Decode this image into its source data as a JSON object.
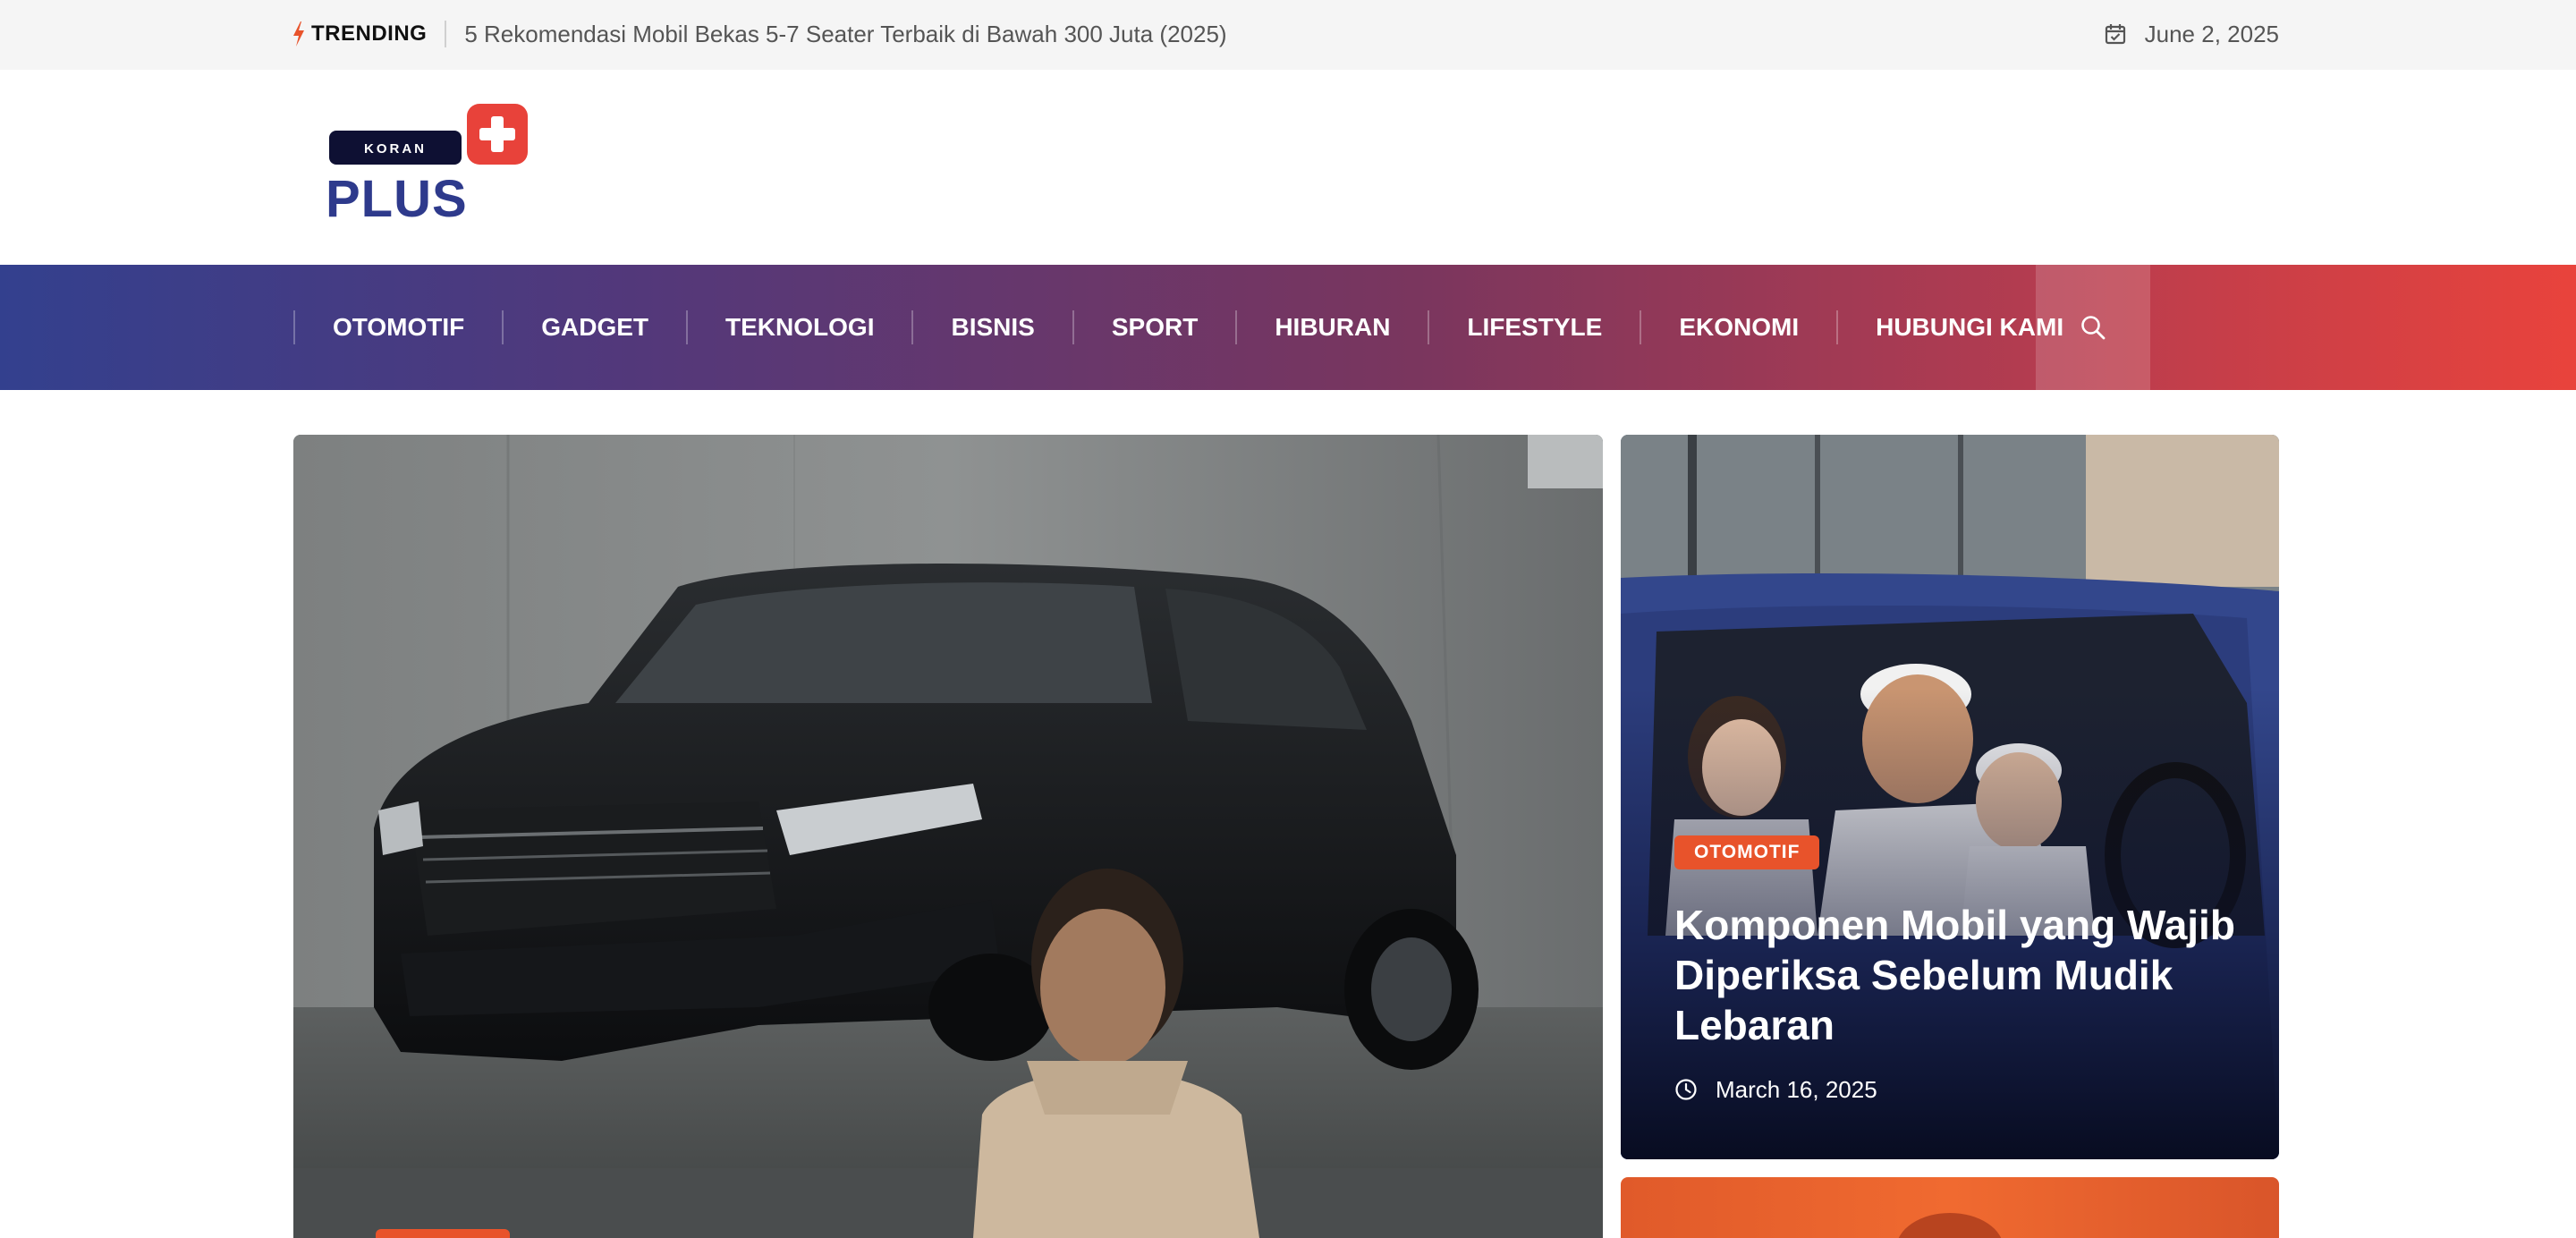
{
  "topbar": {
    "trending_label": "TRENDING",
    "trending_headline": "5 Rekomendasi Mobil Bekas 5-7 Seater Terbaik di Bawah 300 Juta (2025)",
    "date": "June 2, 2025",
    "icons": [
      "bolt-icon",
      "calendar-check-icon"
    ]
  },
  "logo": {
    "top_text": "KORAN",
    "main_text": "PLUS",
    "colors": {
      "navy": "#0e1033",
      "blue": "#2e3a8c",
      "red": "#e8423a"
    }
  },
  "nav": {
    "items": [
      {
        "label": "OTOMOTIF"
      },
      {
        "label": "GADGET"
      },
      {
        "label": "TEKNOLOGI"
      },
      {
        "label": "BISNIS"
      },
      {
        "label": "SPORT"
      },
      {
        "label": "HIBURAN"
      },
      {
        "label": "LIFESTYLE"
      },
      {
        "label": "EKONOMI"
      },
      {
        "label": "HUBUNGI KAMI"
      }
    ],
    "search_icon": "search-icon",
    "gradient": [
      "#33408e",
      "#7a365e",
      "#e9433c"
    ]
  },
  "featured": {
    "main": {
      "image": "black Toyota MPV with young man sitting in front of concrete wall"
    },
    "side": {
      "badge": "OTOMOTIF",
      "title": "Komponen Mobil yang Wajib Diperiksa Sebelum Mudik Lebaran",
      "date": "March 16, 2025",
      "image": "family smiling inside blue car",
      "clock_icon": "clock-icon"
    },
    "accent": "#e8532b"
  }
}
